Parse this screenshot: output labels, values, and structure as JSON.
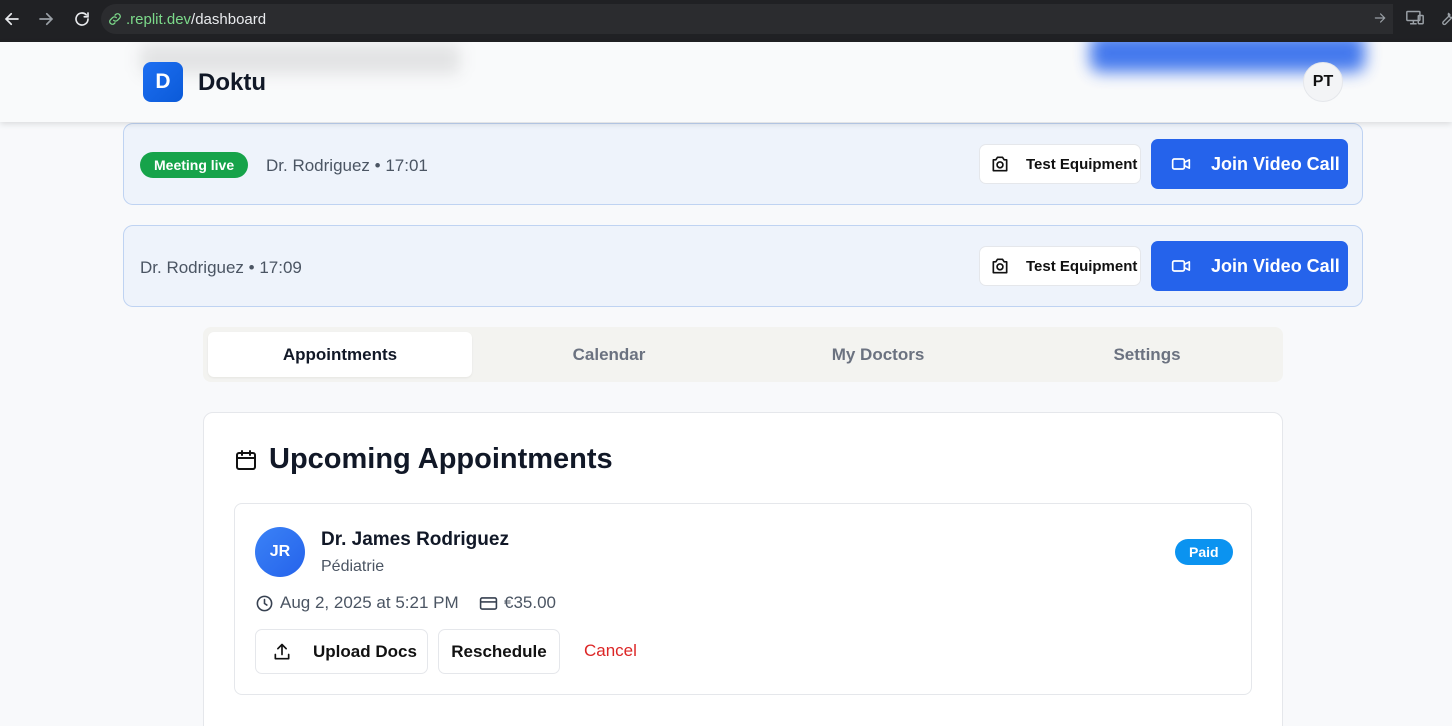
{
  "browser": {
    "url_host": ".replit.dev",
    "url_path": "/dashboard"
  },
  "header": {
    "logo_letter": "D",
    "app_name": "Doktu",
    "user_initials": "PT"
  },
  "banners": [
    {
      "live_badge": "Meeting live",
      "text": "Dr. Rodriguez • 17:01",
      "test_label": "Test Equipment",
      "join_label": "Join Video Call"
    },
    {
      "text": "Dr. Rodriguez • 17:09",
      "test_label": "Test Equipment",
      "join_label": "Join Video Call"
    }
  ],
  "tabs": [
    {
      "label": "Appointments",
      "active": true
    },
    {
      "label": "Calendar"
    },
    {
      "label": "My Doctors"
    },
    {
      "label": "Settings"
    }
  ],
  "upcoming": {
    "title": "Upcoming Appointments",
    "appointment": {
      "initials": "JR",
      "doctor": "Dr. James Rodriguez",
      "specialty": "Pédiatrie",
      "status": "Paid",
      "datetime": "Aug 2, 2025 at 5:21 PM",
      "price": "€35.00",
      "upload_label": "Upload Docs",
      "reschedule_label": "Reschedule",
      "cancel_label": "Cancel"
    }
  },
  "colors": {
    "primary": "#2563eb",
    "live": "#16a34a",
    "paid": "#0b93f0",
    "danger": "#dc2626"
  }
}
